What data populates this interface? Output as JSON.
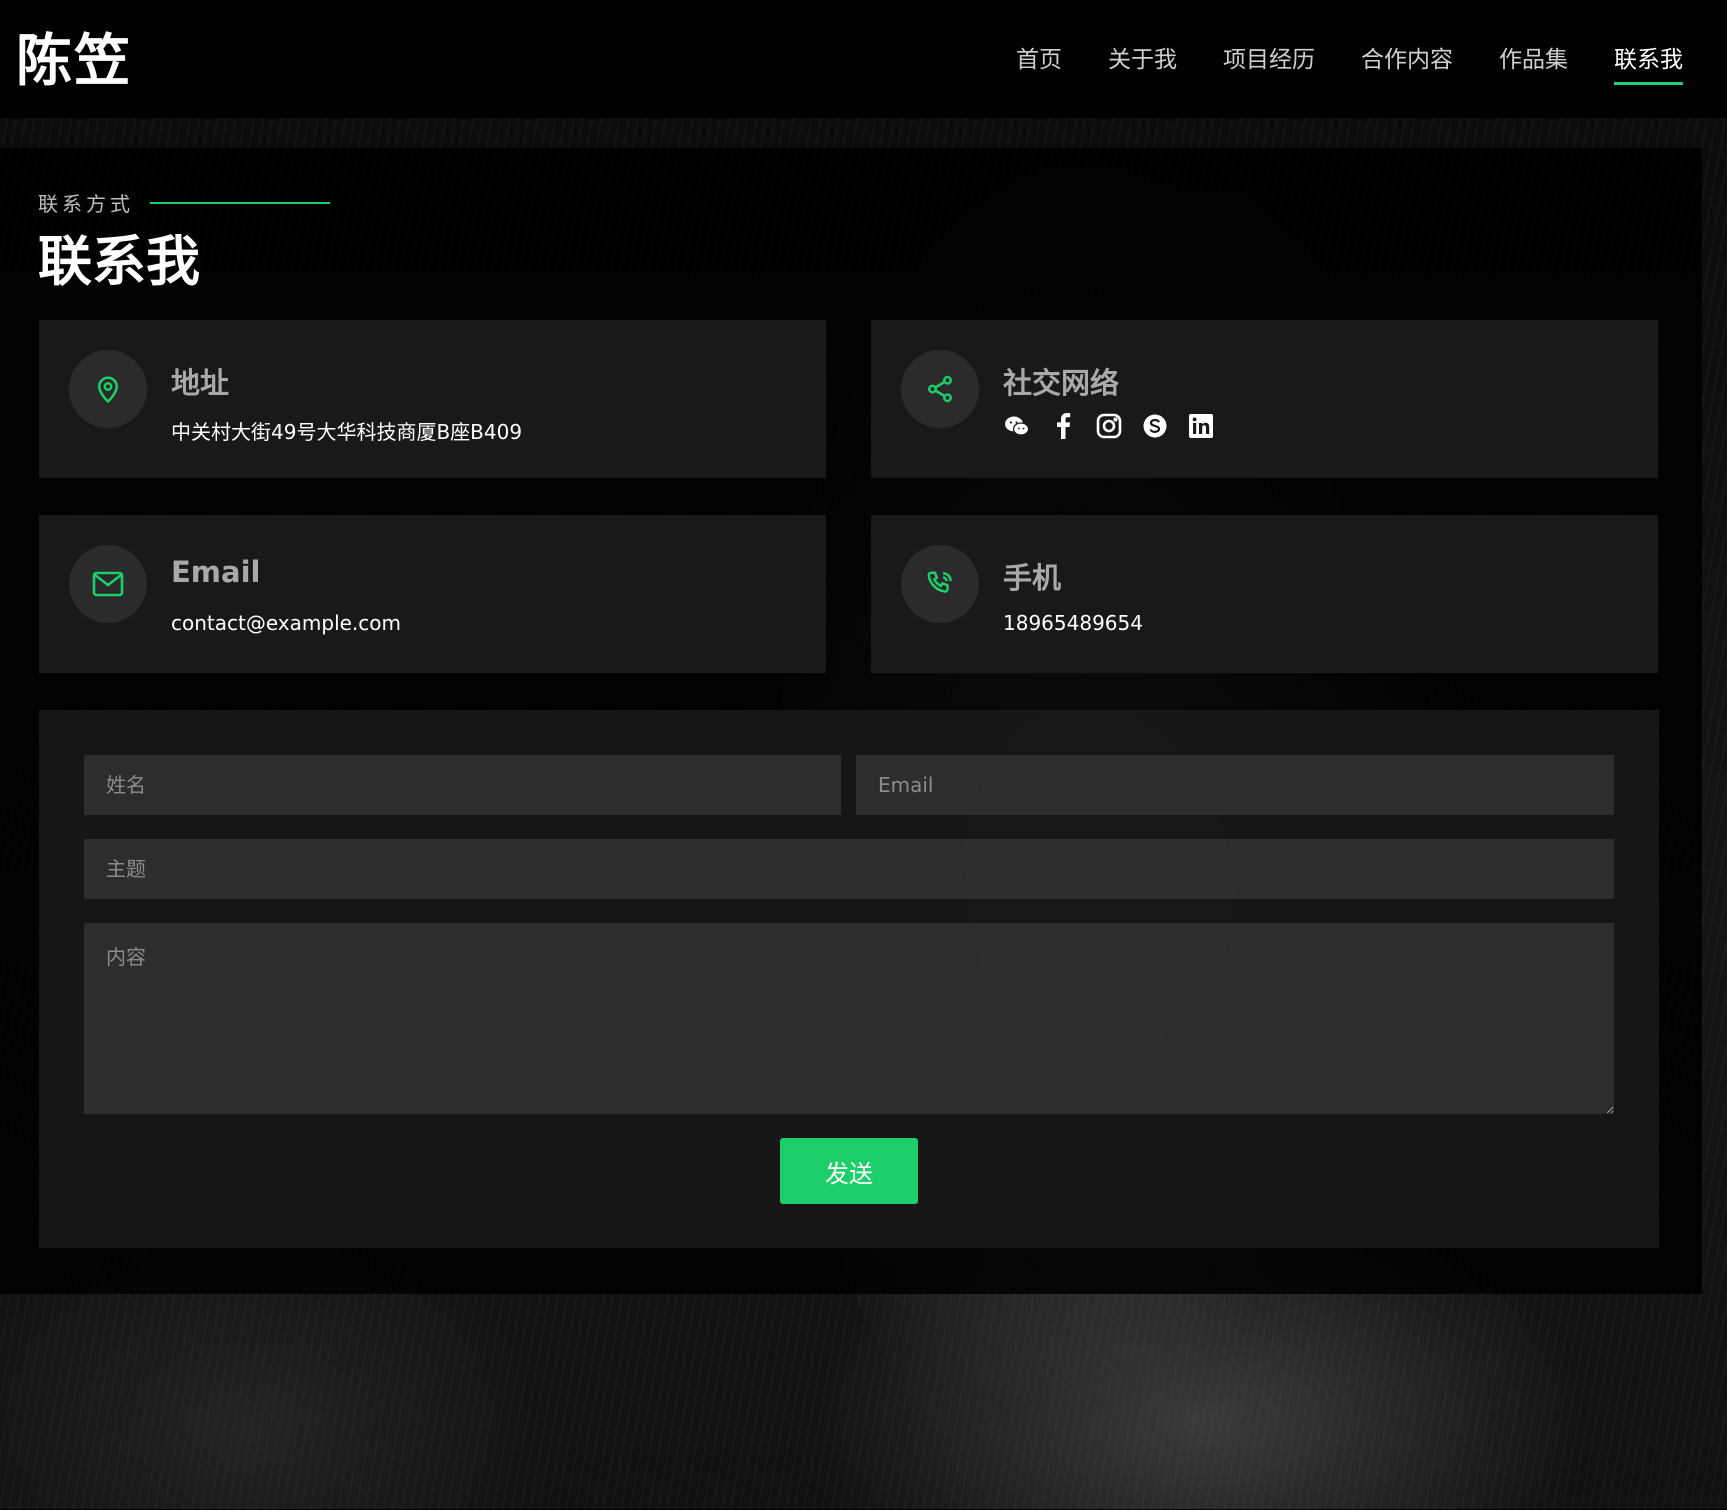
{
  "site": {
    "logo": "陈笠"
  },
  "nav": {
    "items": [
      {
        "label": "首页"
      },
      {
        "label": "关于我"
      },
      {
        "label": "项目经历"
      },
      {
        "label": "合作内容"
      },
      {
        "label": "作品集"
      },
      {
        "label": "联系我"
      }
    ],
    "active": "联系我",
    "accent_color": "#1ccf6a"
  },
  "contact": {
    "subtitle": "联系方式",
    "title": "联系我",
    "address": {
      "title": "地址",
      "value": "中关村大街49号大华科技商厦B座B409",
      "icon": "location-pin-icon"
    },
    "social": {
      "title": "社交网络",
      "icon": "share-icon",
      "links": [
        "wechat-icon",
        "facebook-icon",
        "instagram-icon",
        "skype-icon",
        "linkedin-icon"
      ]
    },
    "email": {
      "title": "Email",
      "value": "contact@example.com",
      "icon": "envelope-icon"
    },
    "phone": {
      "title": "手机",
      "value": "18965489654",
      "icon": "phone-call-icon"
    }
  },
  "form": {
    "name_placeholder": "姓名",
    "email_placeholder": "Email",
    "subject_placeholder": "主题",
    "message_placeholder": "内容",
    "send_label": "发送"
  }
}
